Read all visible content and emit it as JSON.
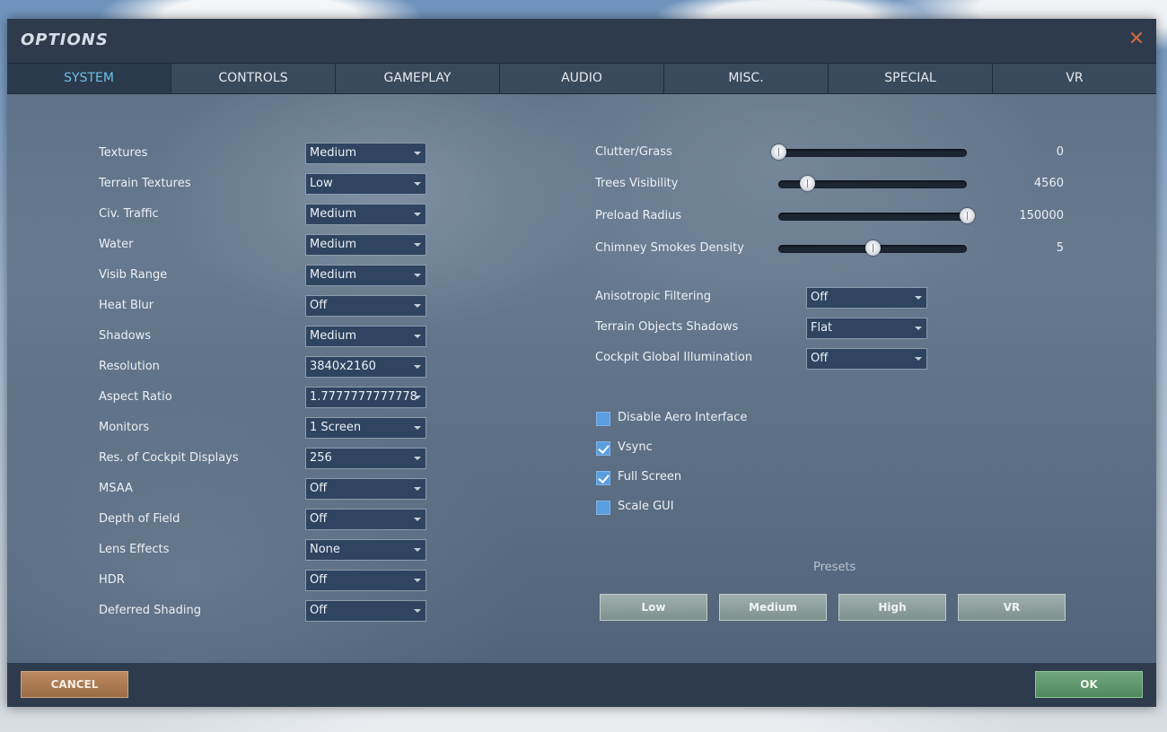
{
  "window": {
    "title": "OPTIONS",
    "close_glyph": "✕"
  },
  "tabs": [
    {
      "label": "SYSTEM",
      "active": true
    },
    {
      "label": "CONTROLS"
    },
    {
      "label": "GAMEPLAY"
    },
    {
      "label": "AUDIO"
    },
    {
      "label": "MISC."
    },
    {
      "label": "SPECIAL"
    },
    {
      "label": "VR"
    }
  ],
  "left_settings": [
    {
      "label": "Textures",
      "value": "Medium"
    },
    {
      "label": "Terrain Textures",
      "value": "Low"
    },
    {
      "label": "Civ. Traffic",
      "value": "Medium"
    },
    {
      "label": "Water",
      "value": "Medium"
    },
    {
      "label": "Visib Range",
      "value": "Medium"
    },
    {
      "label": "Heat Blur",
      "value": "Off"
    },
    {
      "label": "Shadows",
      "value": "Medium"
    },
    {
      "label": "Resolution",
      "value": "3840x2160"
    },
    {
      "label": "Aspect Ratio",
      "value": "1.7777777777778"
    },
    {
      "label": "Monitors",
      "value": "1 Screen"
    },
    {
      "label": "Res. of Cockpit Displays",
      "value": "256"
    },
    {
      "label": "MSAA",
      "value": "Off"
    },
    {
      "label": "Depth of Field",
      "value": "Off"
    },
    {
      "label": "Lens Effects",
      "value": "None"
    },
    {
      "label": "HDR",
      "value": "Off"
    },
    {
      "label": "Deferred Shading",
      "value": "Off"
    }
  ],
  "sliders": [
    {
      "label": "Clutter/Grass",
      "value": "0",
      "fraction": 0.0
    },
    {
      "label": "Trees Visibility",
      "value": "4560",
      "fraction": 0.15
    },
    {
      "label": "Preload Radius",
      "value": "150000",
      "fraction": 1.0
    },
    {
      "label": "Chimney Smokes Density",
      "value": "5",
      "fraction": 0.5
    }
  ],
  "right_settings": [
    {
      "label": "Anisotropic Filtering",
      "value": "Off"
    },
    {
      "label": "Terrain Objects Shadows",
      "value": "Flat"
    },
    {
      "label": "Cockpit Global Illumination",
      "value": "Off"
    }
  ],
  "checkboxes": [
    {
      "label": "Disable Aero Interface",
      "checked": false
    },
    {
      "label": "Vsync",
      "checked": true
    },
    {
      "label": "Full Screen",
      "checked": true
    },
    {
      "label": "Scale GUI",
      "checked": false
    }
  ],
  "presets": {
    "label": "Presets",
    "buttons": [
      "Low",
      "Medium",
      "High",
      "VR"
    ]
  },
  "footer": {
    "cancel_label": "CANCEL",
    "ok_label": "OK"
  },
  "colors": {
    "active_tab_text": "#6cc1e6",
    "cancel_button": "#b07e56",
    "ok_button": "#5f9a6b",
    "close_icon": "#c86a3d",
    "checkbox": "#5b9ee0"
  }
}
